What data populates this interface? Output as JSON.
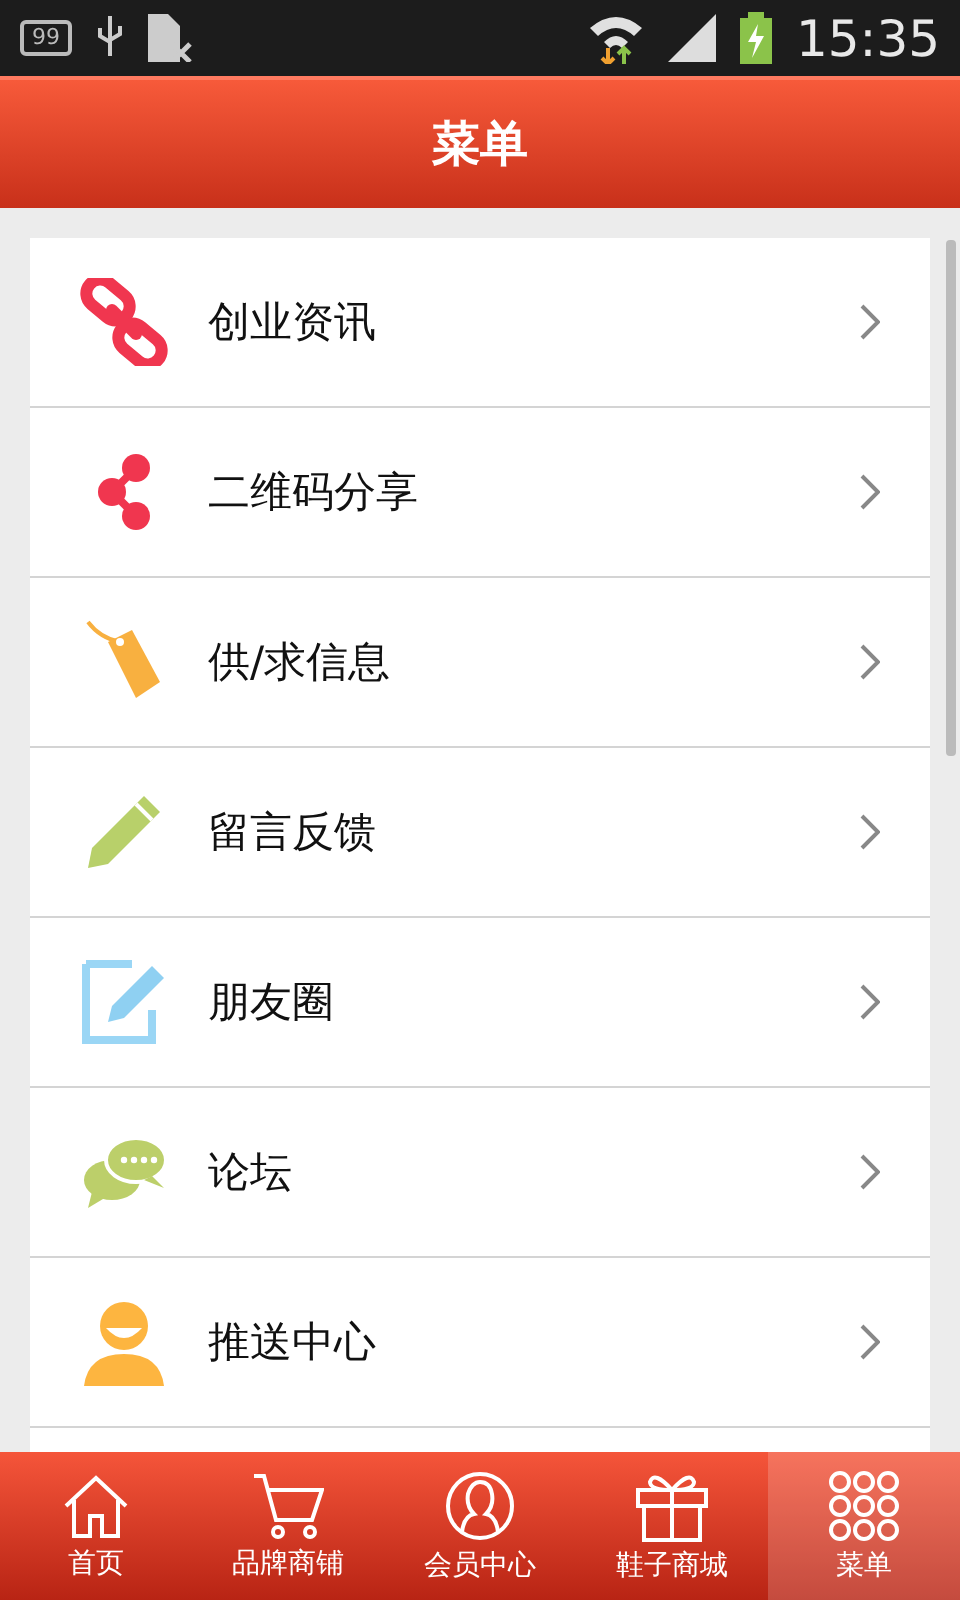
{
  "status_bar": {
    "notification_count": "99",
    "time": "15:35"
  },
  "header": {
    "title": "菜单"
  },
  "menu_items": [
    {
      "label": "创业资讯"
    },
    {
      "label": "二维码分享"
    },
    {
      "label": "供/求信息"
    },
    {
      "label": "留言反馈"
    },
    {
      "label": "朋友圈"
    },
    {
      "label": "论坛"
    },
    {
      "label": "推送中心"
    }
  ],
  "bottom_nav": [
    {
      "label": "首页",
      "selected": false
    },
    {
      "label": "品牌商铺",
      "selected": false
    },
    {
      "label": "会员中心",
      "selected": false
    },
    {
      "label": "鞋子商城",
      "selected": false
    },
    {
      "label": "菜单",
      "selected": true
    }
  ]
}
